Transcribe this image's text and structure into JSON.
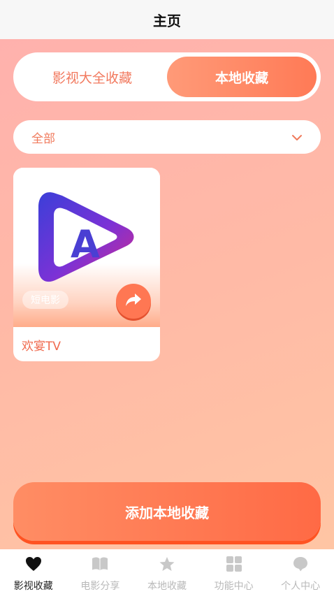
{
  "header": {
    "title": "主页"
  },
  "segment": {
    "tabs": [
      {
        "label": "影视大全收藏",
        "active": false
      },
      {
        "label": "本地收藏",
        "active": true
      }
    ]
  },
  "filter": {
    "selected": "全部",
    "icon": "chevron-down-icon"
  },
  "cards": [
    {
      "tag": "短电影",
      "title": "欢宴TV",
      "logo_letter": "A",
      "share_icon": "share-icon"
    }
  ],
  "add_button": {
    "label": "添加本地收藏"
  },
  "tabbar": {
    "items": [
      {
        "label": "影视收藏",
        "icon": "heart-icon",
        "active": true
      },
      {
        "label": "电影分享",
        "icon": "book-icon",
        "active": false
      },
      {
        "label": "本地收藏",
        "icon": "star-icon",
        "active": false
      },
      {
        "label": "功能中心",
        "icon": "grid-icon",
        "active": false
      },
      {
        "label": "个人中心",
        "icon": "chat-icon",
        "active": false
      }
    ]
  },
  "colors": {
    "accent": "#ff7a56",
    "accent_text": "#f07a5c",
    "inactive": "#b9b9b9"
  }
}
